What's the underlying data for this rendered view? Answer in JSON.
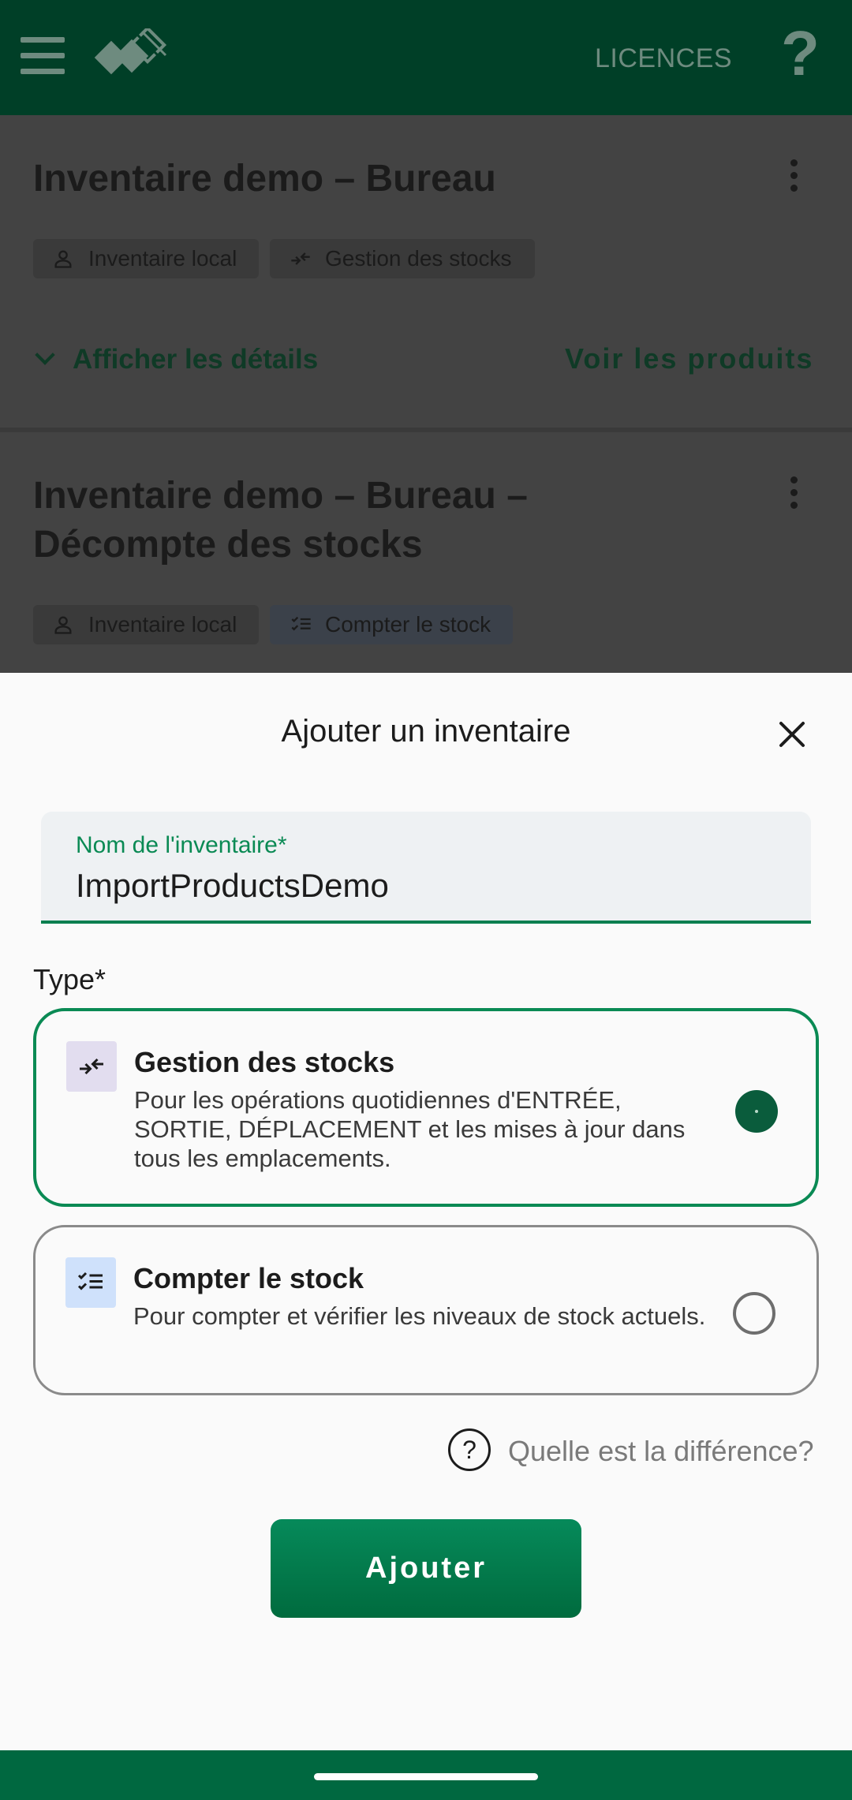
{
  "appbar": {
    "licences_label": "LICENCES",
    "help_label": "?"
  },
  "inventories": [
    {
      "title": "Inventaire demo – Bureau",
      "chip_local": "Inventaire local",
      "chip_type": "Gestion des stocks",
      "details_label": "Afficher les détails",
      "products_label": "Voir les produits"
    },
    {
      "title": "Inventaire demo – Bureau – Décompte des stocks",
      "chip_local": "Inventaire local",
      "chip_type": "Compter le stock"
    }
  ],
  "sheet": {
    "title": "Ajouter un inventaire",
    "name_field": {
      "label": "Nom de l'inventaire*",
      "value": "ImportProductsDemo"
    },
    "type_label": "Type*",
    "options": [
      {
        "title": "Gestion des stocks",
        "description": "Pour les opérations quotidiennes d'ENTRÉE, SORTIE, DÉPLACEMENT et les mises à jour dans tous les emplacements.",
        "selected": true
      },
      {
        "title": "Compter le stock",
        "description": "Pour compter et vérifier les niveaux de stock actuels.",
        "selected": false
      }
    ],
    "difference_icon": "?",
    "difference_link": "Quelle est la différence?",
    "add_button": "Ajouter"
  },
  "colors": {
    "appbar": "#003f27",
    "accent": "#0a8a54",
    "button": "#006b3e",
    "navbar": "#006840"
  }
}
